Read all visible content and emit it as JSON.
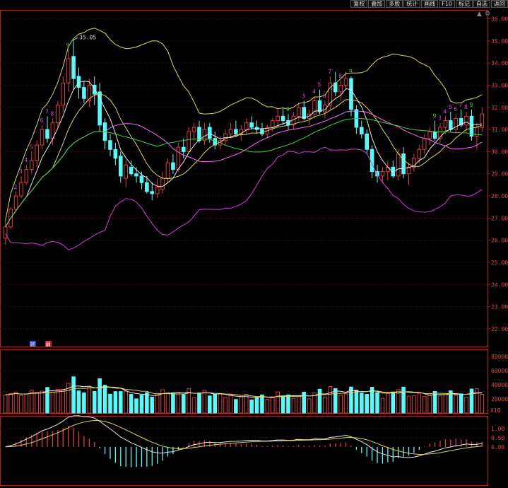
{
  "toolbar": {
    "buttons": [
      "复权",
      "叠加",
      "多股",
      "统计",
      "画线",
      "F10",
      "标记",
      "自选",
      "返回"
    ],
    "corner_icons": [
      "up-arrow-icon",
      "settings-icon"
    ]
  },
  "colors": {
    "background": "#000000",
    "axis": "#aa2222",
    "up": "#e03c3c",
    "down": "#54fcfc",
    "ma_yellow": "#d8d860",
    "ma_pink": "#ff66ff",
    "ma_white": "#e8e8e8",
    "ma_green": "#44cc44",
    "boll_upper": "#d8d860",
    "boll_lower": "#cc44cc"
  },
  "chart_data": [
    {
      "type": "candlestick",
      "panel": "price",
      "ylim": [
        21.2,
        36.4
      ],
      "yticks": [
        "36.00",
        "35.00",
        "34.00",
        "33.00",
        "32.00",
        "31.00",
        "30.00",
        "29.00",
        "28.00",
        "27.00",
        "26.00",
        "25.00",
        "24.00",
        "23.00",
        "22.00"
      ],
      "high_annotation": "35.05",
      "tags": [
        "财",
        "弱"
      ],
      "candles_ohlc": [
        [
          26.1,
          26.9,
          25.8,
          26.6
        ],
        [
          26.6,
          27.5,
          26.5,
          27.4
        ],
        [
          27.4,
          28.2,
          27.3,
          28.0
        ],
        [
          28.0,
          28.9,
          27.9,
          28.6
        ],
        [
          28.6,
          29.4,
          28.5,
          29.2
        ],
        [
          29.2,
          30.0,
          29.0,
          29.6
        ],
        [
          29.6,
          30.5,
          29.3,
          30.3
        ],
        [
          30.3,
          31.2,
          30.1,
          31.0
        ],
        [
          31.0,
          31.6,
          30.4,
          30.6
        ],
        [
          30.6,
          31.5,
          30.3,
          31.3
        ],
        [
          31.3,
          32.3,
          31.1,
          32.1
        ],
        [
          32.1,
          33.4,
          31.8,
          33.1
        ],
        [
          33.1,
          34.6,
          32.7,
          34.2
        ],
        [
          34.3,
          35.05,
          32.8,
          33.3
        ],
        [
          33.4,
          33.8,
          32.4,
          32.9
        ],
        [
          32.9,
          33.2,
          32.2,
          32.4
        ],
        [
          32.3,
          33.3,
          32.0,
          33.0
        ],
        [
          33.0,
          33.4,
          32.1,
          32.6
        ],
        [
          32.7,
          33.1,
          30.9,
          31.2
        ],
        [
          31.3,
          31.5,
          30.1,
          30.5
        ],
        [
          30.5,
          30.8,
          29.8,
          30.1
        ],
        [
          30.1,
          30.4,
          29.4,
          29.7
        ],
        [
          29.8,
          30.0,
          28.6,
          28.9
        ],
        [
          28.8,
          29.6,
          28.4,
          29.4
        ],
        [
          29.3,
          29.6,
          28.9,
          29.0
        ],
        [
          29.0,
          29.3,
          28.6,
          28.9
        ],
        [
          28.9,
          29.1,
          28.3,
          28.6
        ],
        [
          28.6,
          28.9,
          28.1,
          28.2
        ],
        [
          28.2,
          28.6,
          27.8,
          28.1
        ],
        [
          28.1,
          28.8,
          27.9,
          28.4
        ],
        [
          28.3,
          29.1,
          28.1,
          28.8
        ],
        [
          28.8,
          29.7,
          28.6,
          29.5
        ],
        [
          29.5,
          29.9,
          29.0,
          29.2
        ],
        [
          29.2,
          30.4,
          29.1,
          30.2
        ],
        [
          30.2,
          30.6,
          29.7,
          30.0
        ],
        [
          30.0,
          31.1,
          29.9,
          30.9
        ],
        [
          30.9,
          31.3,
          30.5,
          31.1
        ],
        [
          31.1,
          31.4,
          30.4,
          30.5
        ],
        [
          30.5,
          31.3,
          30.3,
          31.0
        ],
        [
          31.1,
          31.3,
          30.4,
          30.6
        ],
        [
          30.6,
          30.9,
          30.1,
          30.3
        ],
        [
          30.3,
          30.7,
          30.1,
          30.5
        ],
        [
          30.5,
          31.0,
          30.3,
          30.8
        ],
        [
          30.8,
          31.3,
          30.6,
          31.0
        ],
        [
          31.0,
          31.4,
          30.7,
          30.8
        ],
        [
          30.8,
          31.2,
          30.5,
          31.0
        ],
        [
          31.0,
          31.5,
          30.8,
          31.3
        ],
        [
          31.3,
          31.6,
          31.0,
          31.1
        ],
        [
          31.1,
          31.4,
          30.8,
          31.0
        ],
        [
          31.0,
          31.3,
          30.7,
          30.8
        ],
        [
          30.8,
          31.2,
          30.6,
          31.1
        ],
        [
          31.1,
          31.5,
          30.9,
          31.4
        ],
        [
          31.4,
          31.9,
          31.1,
          31.6
        ],
        [
          31.6,
          32.0,
          31.2,
          31.4
        ],
        [
          31.4,
          31.7,
          31.0,
          31.2
        ],
        [
          31.2,
          31.8,
          31.0,
          31.6
        ],
        [
          31.6,
          32.2,
          31.4,
          32.0
        ],
        [
          32.0,
          32.3,
          31.4,
          31.5
        ],
        [
          31.5,
          31.9,
          31.2,
          31.7
        ],
        [
          31.7,
          32.5,
          31.5,
          32.3
        ],
        [
          32.3,
          32.8,
          31.7,
          31.8
        ],
        [
          31.8,
          32.3,
          31.5,
          32.1
        ],
        [
          32.1,
          33.4,
          31.9,
          33.1
        ],
        [
          33.1,
          33.6,
          32.5,
          32.7
        ],
        [
          32.7,
          33.2,
          32.3,
          33.0
        ],
        [
          33.0,
          33.6,
          32.8,
          33.3
        ],
        [
          33.3,
          33.4,
          31.6,
          31.9
        ],
        [
          31.9,
          32.1,
          30.8,
          31.1
        ],
        [
          31.1,
          31.4,
          30.6,
          30.8
        ],
        [
          30.8,
          31.0,
          29.9,
          30.1
        ],
        [
          30.1,
          30.3,
          28.8,
          29.1
        ],
        [
          29.1,
          29.4,
          28.6,
          28.9
        ],
        [
          28.9,
          29.3,
          28.6,
          29.1
        ],
        [
          29.1,
          29.6,
          28.7,
          29.3
        ],
        [
          29.3,
          29.6,
          28.8,
          28.9
        ],
        [
          28.9,
          30.1,
          28.7,
          29.9
        ],
        [
          29.9,
          30.2,
          28.8,
          29.0
        ],
        [
          29.0,
          29.5,
          28.5,
          29.3
        ],
        [
          29.3,
          29.9,
          29.1,
          29.7
        ],
        [
          29.7,
          30.3,
          29.5,
          30.1
        ],
        [
          30.1,
          30.8,
          29.9,
          30.6
        ],
        [
          30.6,
          31.1,
          30.3,
          30.9
        ],
        [
          30.9,
          31.4,
          30.5,
          30.6
        ],
        [
          30.6,
          31.3,
          30.4,
          31.1
        ],
        [
          31.1,
          31.6,
          30.8,
          31.4
        ],
        [
          31.4,
          31.8,
          30.9,
          31.0
        ],
        [
          31.0,
          31.7,
          30.8,
          31.5
        ],
        [
          31.5,
          31.9,
          31.1,
          31.2
        ],
        [
          31.2,
          31.8,
          30.9,
          31.6
        ],
        [
          31.6,
          31.9,
          30.5,
          30.7
        ],
        [
          30.7,
          31.3,
          30.1,
          31.1
        ],
        [
          31.1,
          32.0,
          30.9,
          31.7
        ]
      ],
      "annotations_digits": [
        "2",
        "3",
        "4",
        "5",
        "6",
        "7",
        "8",
        "9",
        "9",
        "3",
        "4",
        "5",
        "6",
        "7",
        "8",
        "9",
        "9",
        "3",
        "4",
        "5",
        "6",
        "7",
        "8",
        "9"
      ]
    },
    {
      "type": "bar",
      "panel": "volume",
      "ylim": [
        0,
        90000
      ],
      "yticks": [
        "80000",
        "60000",
        "40000",
        "20000"
      ],
      "unit_label": "X10"
    },
    {
      "type": "bar",
      "panel": "macd",
      "ylim": [
        -2.1,
        1.7
      ],
      "yticks": [
        "1.00",
        "0.50",
        "0.00"
      ]
    }
  ]
}
